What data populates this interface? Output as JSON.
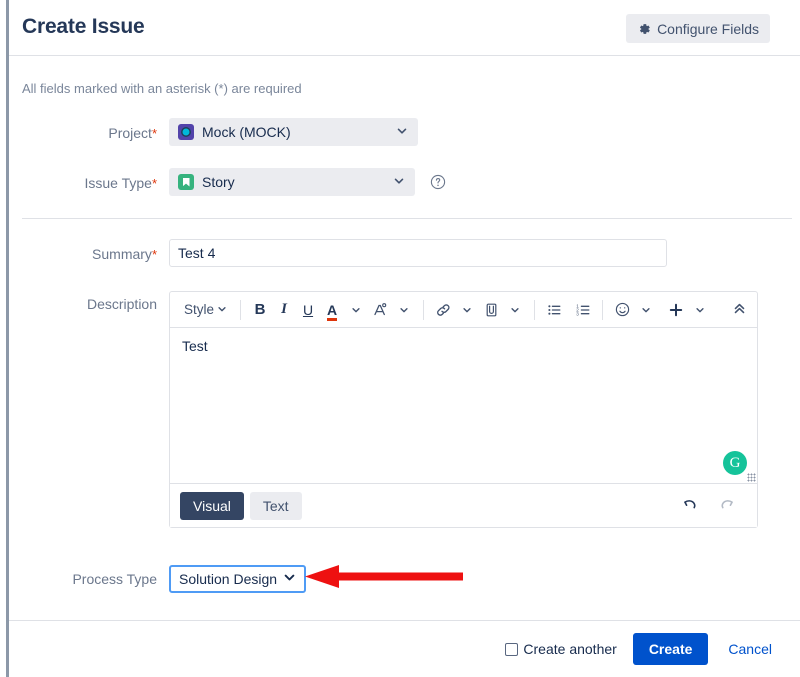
{
  "header": {
    "title": "Create Issue",
    "configure_fields_label": "Configure Fields",
    "gear_icon": "gear-icon"
  },
  "form": {
    "required_note": "All fields marked with an asterisk (*) are required",
    "required_marker": "*",
    "project": {
      "label": "Project",
      "value": "Mock (MOCK)",
      "icon": "project-avatar-icon",
      "required": true
    },
    "issue_type": {
      "label": "Issue Type",
      "value": "Story",
      "icon": "story-icon",
      "help_icon": "question-circle-icon",
      "required": true
    },
    "summary": {
      "label": "Summary",
      "value": "Test 4",
      "placeholder": "",
      "required": true
    },
    "description": {
      "label": "Description",
      "content": "Test",
      "toolbar": {
        "style_label": "Style",
        "bold": "B",
        "italic": "I",
        "underline": "U",
        "text_color": "A",
        "highlight_color": "A",
        "link_icon": "link-icon",
        "attach_icon": "paperclip-icon",
        "bullet_list_icon": "bullet-list-icon",
        "numbered_list_icon": "numbered-list-icon",
        "emoji_icon": "emoji-icon",
        "insert_icon": "plus-icon",
        "collapse_icon": "chevron-double-up-icon"
      },
      "tabs": {
        "visual": "Visual",
        "text": "Text",
        "active": "Visual"
      },
      "undo_icon": "undo-icon",
      "redo_icon": "redo-icon",
      "grammarly_badge": "G"
    },
    "process_type": {
      "label": "Process Type",
      "value": "Solution Design",
      "options": [
        "Solution Design"
      ],
      "focus_color": "#4f9bf5"
    }
  },
  "annotation": {
    "arrow_color": "#ee1111",
    "target": "process-type-select"
  },
  "footer": {
    "create_another_label": "Create another",
    "create_another_checked": false,
    "create_label": "Create",
    "cancel_label": "Cancel",
    "primary_color": "#0052cc"
  }
}
